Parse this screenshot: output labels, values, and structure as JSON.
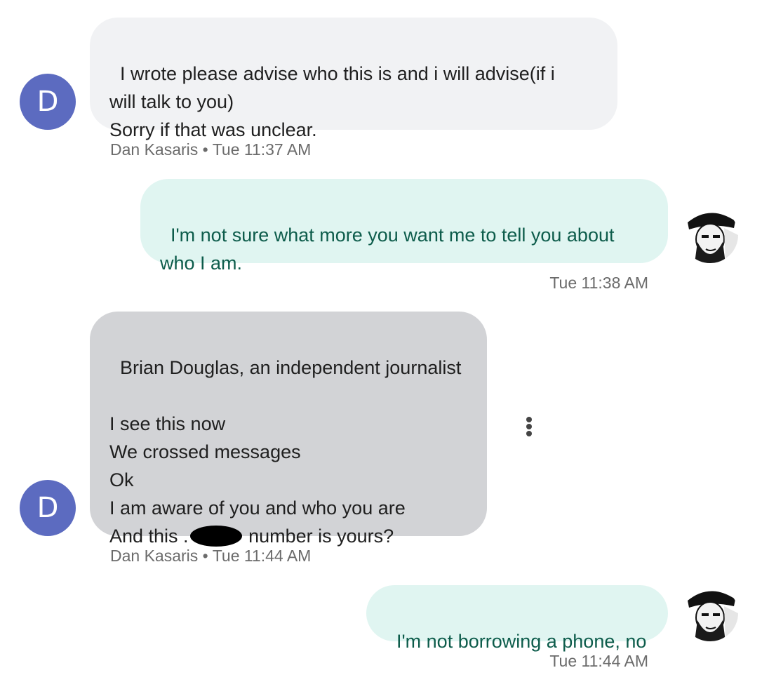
{
  "messages": [
    {
      "direction": "incoming",
      "avatar_letter": "D",
      "text": "I wrote please advise who this is and i will advise(if i\nwill talk to you)\nSorry if that was unclear.",
      "sender": "Dan Kasaris",
      "time": "Tue 11:37 AM"
    },
    {
      "direction": "outgoing",
      "text": "I'm not sure what more you want me to tell you about\nwho I am.",
      "time": "Tue 11:38 AM"
    },
    {
      "direction": "incoming",
      "avatar_letter": "D",
      "text_before_redaction": "Brian Douglas, an independent journalist\n\nI see this now\nWe crossed messages\nOk\nI am aware of you and who you are\nAnd this .",
      "text_after_redaction": " number is yours?",
      "sender": "Dan Kasaris",
      "time": "Tue 11:44 AM"
    },
    {
      "direction": "outgoing",
      "text": "I'm not borrowing a phone, no",
      "time": "Tue 11:44 AM"
    }
  ],
  "meta_separator": " • ",
  "icons": {
    "more_options": "more-vertical-icon",
    "user_avatar": "user-photo-avatar"
  },
  "colors": {
    "avatar_bg": "#5c6bc0",
    "incoming_bubble": "#f1f2f4",
    "incoming_bubble_selected": "#d2d3d6",
    "outgoing_bubble": "#e0f5f1",
    "outgoing_text": "#0d5c4b"
  }
}
